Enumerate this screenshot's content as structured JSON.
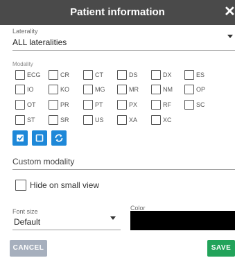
{
  "dialog": {
    "title": "Patient information",
    "close_glyph": "✕"
  },
  "laterality": {
    "label": "Laterality",
    "value": "ALL lateralities"
  },
  "modality": {
    "label": "Modality",
    "rows": [
      [
        "ECG",
        "CR",
        "CT",
        "DS",
        "DX",
        "ES"
      ],
      [
        "IO",
        "KO",
        "MG",
        "MR",
        "NM",
        "OP"
      ],
      [
        "OT",
        "PR",
        "PT",
        "PX",
        "RF",
        "SC"
      ],
      [
        "ST",
        "SR",
        "US",
        "XA",
        "XC"
      ]
    ],
    "buttons": [
      {
        "icon": "check-all-icon"
      },
      {
        "icon": "uncheck-all-icon"
      },
      {
        "icon": "invert-selection-icon"
      }
    ]
  },
  "custom_modality": {
    "placeholder": "Custom modality"
  },
  "hide_on_small_view": {
    "label": "Hide on small view",
    "checked": false
  },
  "font_size": {
    "label": "Font size",
    "value": "Default"
  },
  "color": {
    "label": "Color",
    "value": "#000000"
  },
  "actions": {
    "cancel_label": "CANCEL",
    "save_label": "SAVE"
  },
  "colors": {
    "title_bar": "#4a4a4a",
    "primary_button": "#1e88d8",
    "save_button": "#22a35a",
    "cancel_button": "#a6afbd"
  }
}
